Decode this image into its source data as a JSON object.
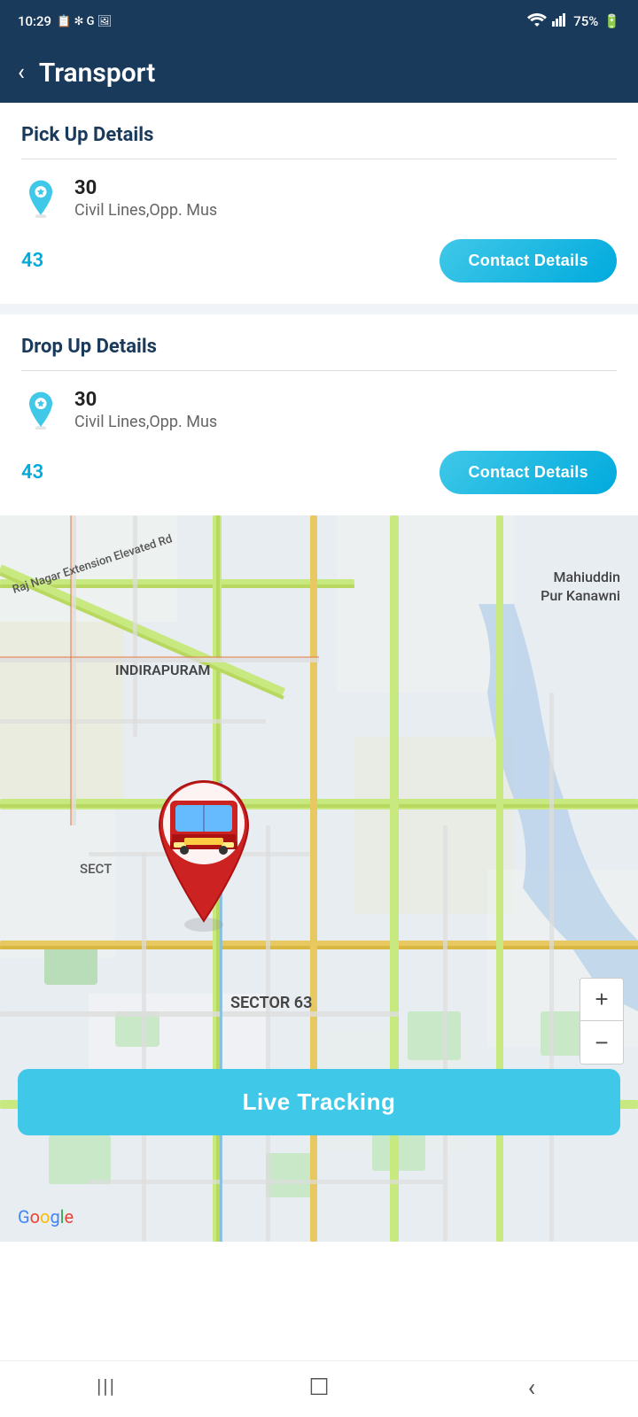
{
  "status_bar": {
    "time": "10:29",
    "battery": "75%",
    "wifi_icon": "wifi",
    "signal_icon": "signal",
    "battery_icon": "battery"
  },
  "header": {
    "back_label": "‹",
    "title": "Transport"
  },
  "pickup": {
    "section_title": "Pick Up Details",
    "location_number": "30",
    "location_address": "Civil Lines,Opp. Mus",
    "route_number": "43",
    "contact_btn_label": "Contact Details"
  },
  "dropup": {
    "section_title": "Drop Up Details",
    "location_number": "30",
    "location_address": "Civil Lines,Opp. Mus",
    "route_number": "43",
    "contact_btn_label": "Contact Details"
  },
  "map": {
    "label_indirapuram": "INDIRAPURAM",
    "label_sector63": "SECTOR 63",
    "label_mahiuddinpur": "Mahiuddin\nPur Kanawni",
    "label_sect": "SECT",
    "label_road": "Raj Nagar Extension Elevated Rd",
    "live_tracking_label": "Live Tracking",
    "zoom_in": "+",
    "zoom_out": "−"
  },
  "google_logo": {
    "g": "G",
    "o1": "o",
    "o2": "o",
    "g2": "g",
    "l": "l",
    "e": "e"
  },
  "nav_bar": {
    "menu_icon": "|||",
    "home_icon": "☐",
    "back_icon": "‹"
  }
}
